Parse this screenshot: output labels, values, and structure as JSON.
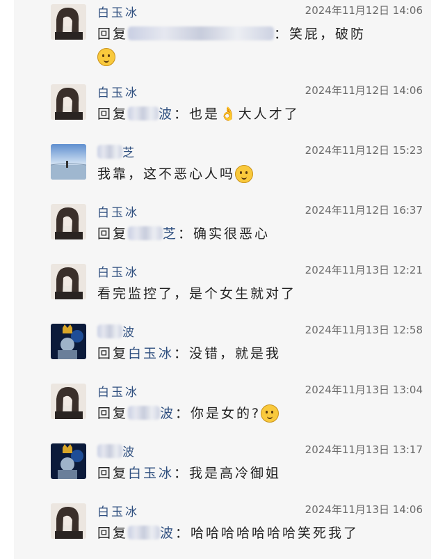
{
  "messages": [
    {
      "name": "白玉冰",
      "avatar": "avatar-girl",
      "time": "2024年11月12日 14:06",
      "prefix": "回复",
      "reply_to": "",
      "reply_blur": true,
      "blur_width": 210,
      "content": "：笑屁，破防",
      "emoji": "laughing-emoji",
      "emoji_wrap": true
    },
    {
      "name": "白玉冰",
      "avatar": "avatar-girl",
      "time": "2024年11月12日 14:06",
      "prefix": "回复",
      "reply_to": "波",
      "reply_blur": true,
      "blur_width": 44,
      "content": "：也是👌大人才了",
      "emoji": "",
      "emoji_wrap": false
    },
    {
      "name": "芝",
      "avatar": "avatar-lake",
      "time": "2024年11月12日 15:23",
      "prefix": "",
      "reply_to": "",
      "reply_blur": false,
      "blur_width": 0,
      "content": "我靠，这不恶心人吗",
      "emoji": "pleading-emoji",
      "emoji_wrap": false,
      "name_blur": true
    },
    {
      "name": "白玉冰",
      "avatar": "avatar-girl",
      "time": "2024年11月12日 16:37",
      "prefix": "回复",
      "reply_to": "芝",
      "reply_blur": true,
      "blur_width": 50,
      "content": "：确实很恶心",
      "emoji": "",
      "emoji_wrap": false
    },
    {
      "name": "白玉冰",
      "avatar": "avatar-girl",
      "time": "2024年11月13日 12:21",
      "prefix": "",
      "reply_to": "",
      "reply_blur": false,
      "blur_width": 0,
      "content": "看完监控了，是个女生就对了",
      "emoji": "",
      "emoji_wrap": false
    },
    {
      "name": "波",
      "avatar": "avatar-king",
      "time": "2024年11月13日 12:58",
      "prefix": "回复",
      "reply_to": "白玉冰",
      "reply_blur": false,
      "blur_width": 0,
      "content": "：没错，就是我",
      "emoji": "",
      "emoji_wrap": false,
      "name_blur": true
    },
    {
      "name": "白玉冰",
      "avatar": "avatar-girl",
      "time": "2024年11月13日 13:04",
      "prefix": "回复",
      "reply_to": "波",
      "reply_blur": true,
      "blur_width": 46,
      "content": "：你是女的?",
      "emoji": "thinking-emoji",
      "emoji_wrap": false
    },
    {
      "name": "波",
      "avatar": "avatar-king",
      "time": "2024年11月13日 13:17",
      "prefix": "回复",
      "reply_to": "白玉冰",
      "reply_blur": false,
      "blur_width": 0,
      "content": "：我是高冷御姐",
      "emoji": "",
      "emoji_wrap": false,
      "name_blur": true
    },
    {
      "name": "白玉冰",
      "avatar": "avatar-girl",
      "time": "2024年11月13日 14:06",
      "prefix": "回复",
      "reply_to": "波",
      "reply_blur": true,
      "blur_width": 46,
      "content": "：哈哈哈哈哈哈哈笑死我了",
      "emoji": "",
      "emoji_wrap": false
    }
  ]
}
